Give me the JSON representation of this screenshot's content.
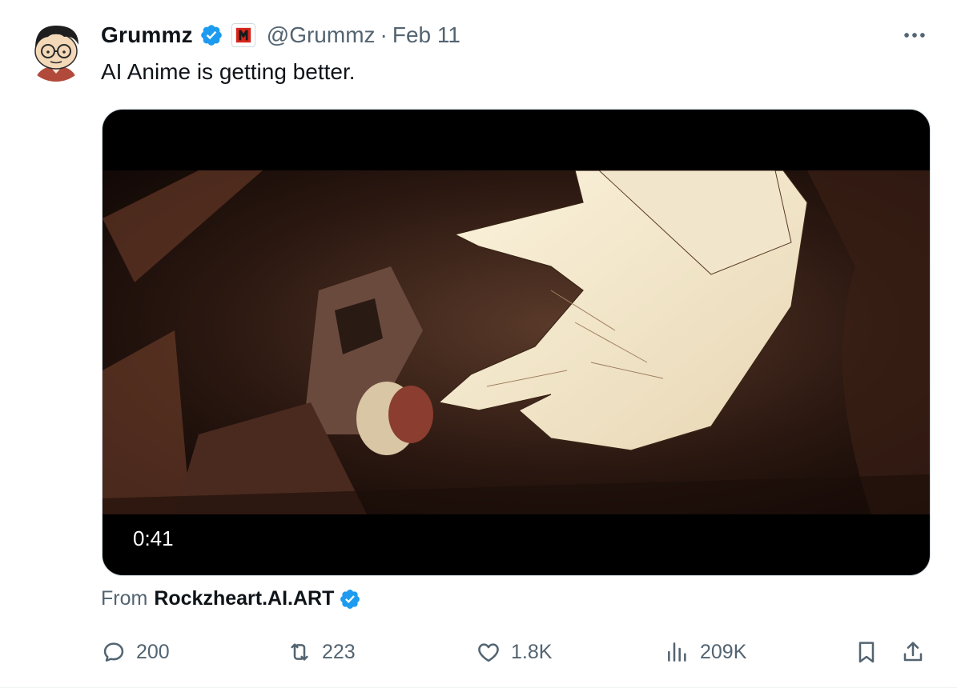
{
  "tweet": {
    "author": {
      "display_name": "Grummz",
      "handle": "@Grummz",
      "verified_icon": "verified-badge-icon",
      "affiliate_icon": "affiliate-badge-icon"
    },
    "separator": "·",
    "date": "Feb 11",
    "text": "AI Anime is getting better.",
    "media": {
      "type": "video",
      "duration": "0:41"
    },
    "from": {
      "label": "From",
      "account": "Rockzheart.AI.ART"
    }
  },
  "actions": {
    "reply": {
      "icon": "reply-icon",
      "count": "200"
    },
    "retweet": {
      "icon": "retweet-icon",
      "count": "223"
    },
    "like": {
      "icon": "heart-icon",
      "count": "1.8K"
    },
    "views": {
      "icon": "views-icon",
      "count": "209K"
    },
    "bookmark": {
      "icon": "bookmark-icon"
    },
    "share": {
      "icon": "share-icon"
    }
  },
  "colors": {
    "verified": "#1d9bf0",
    "secondary_text": "#536471",
    "primary_text": "#0f1419",
    "affiliate": "#d6261c"
  }
}
